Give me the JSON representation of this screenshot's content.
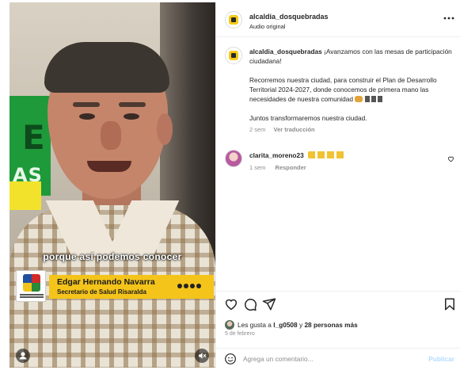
{
  "video": {
    "subtitle": "porque así podemos conocer",
    "name": "Edgar Hernando Navarra",
    "role": "Secretario de Salud Risaralda",
    "sign_letters": [
      "E",
      "AS"
    ]
  },
  "header": {
    "username": "alcaldia_dosquebradas",
    "audio": "Audio original",
    "more_icon": "more-horizontal-icon"
  },
  "caption": {
    "username": "alcaldia_dosquebradas",
    "line1": "¡Avanzamos con las mesas de participación ciudadana!",
    "line2": "Recorremos nuestra ciudad, para construir el Plan de Desarrollo Territorial 2024-2027, donde conocemos de primera mano las necesidades de nuestra comunidad",
    "line3": "Juntos transformaremos nuestra ciudad.",
    "age": "2 sem",
    "translate": "Ver traducción"
  },
  "comment": {
    "username": "clarita_moreno23",
    "age": "1 sem",
    "reply": "Responder"
  },
  "actions": {
    "icons": [
      "heart-icon",
      "comment-icon",
      "share-icon",
      "bookmark-icon"
    ],
    "likes_prefix": "Les gusta a ",
    "likes_user": "l_g0508",
    "likes_mid": " y ",
    "likes_count": "28 personas más",
    "date": "5 de febrero"
  },
  "add_comment": {
    "placeholder": "Agrega un comentario...",
    "publish": "Publicar"
  },
  "colors": {
    "accent_yellow": "#f4c41b",
    "sign_green": "#1e9a3a",
    "link_disabled": "#b3dbff",
    "muted_text": "#8e8e8e"
  }
}
